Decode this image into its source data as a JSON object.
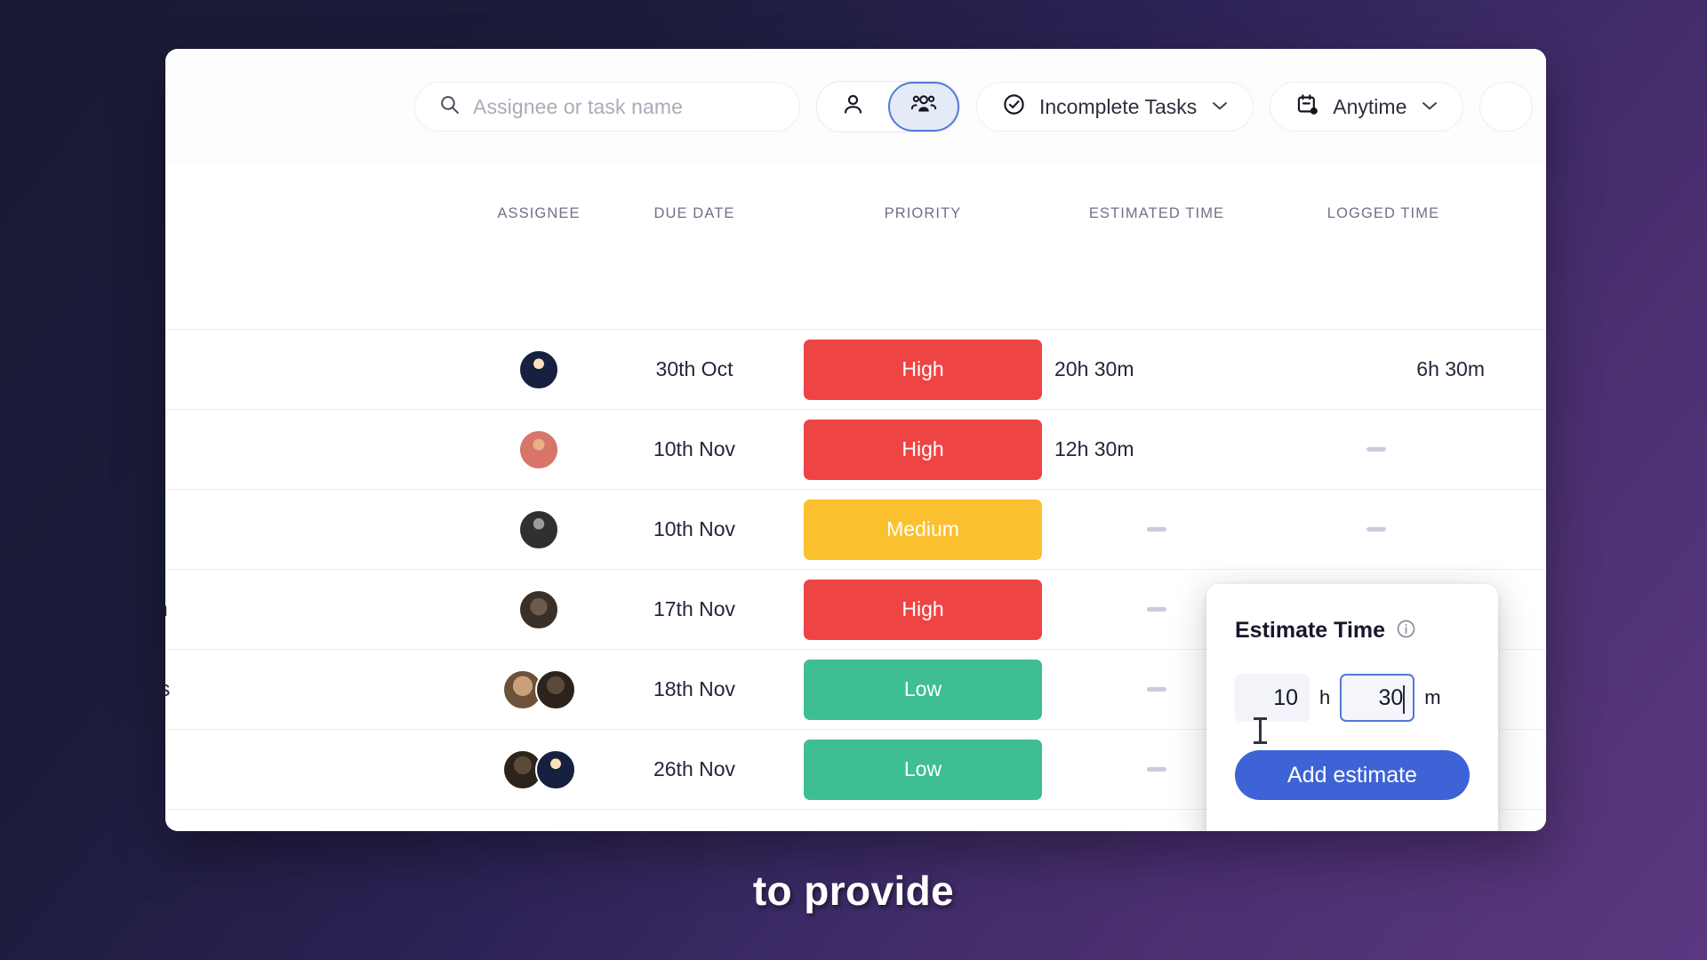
{
  "toolbar": {
    "search": {
      "placeholder": "Assignee or task name",
      "icon": "search-icon"
    },
    "view_toggle": {
      "single_icon": "person-icon",
      "group_icon": "people-group-icon",
      "selected": "group"
    },
    "status_filter": {
      "label": "Incomplete Tasks",
      "icon": "check-circle-icon",
      "chevron": "∨"
    },
    "date_filter": {
      "label": "Anytime",
      "icon": "calendar-icon",
      "chevron": "∨"
    },
    "clipped_filter": {
      "label": ""
    }
  },
  "table": {
    "columns": [
      "ASSIGNEE",
      "DUE DATE",
      "PRIORITY",
      "ESTIMATED TIME",
      "LOGGED TIME"
    ],
    "rows": [
      {
        "task_fragment": "",
        "assignees": 1,
        "due_date": "30th Oct",
        "priority": "High",
        "estimated_time": "20h 30m",
        "logged_time": "6h 30m"
      },
      {
        "task_fragment": "",
        "assignees": 1,
        "due_date": "10th Nov",
        "priority": "High",
        "estimated_time": "12h 30m",
        "logged_time": "—"
      },
      {
        "task_fragment": "",
        "assignees": 1,
        "due_date": "10th Nov",
        "priority": "Medium",
        "estimated_time": "—",
        "logged_time": "—"
      },
      {
        "task_fragment": "on",
        "assignees": 1,
        "due_date": "17th Nov",
        "priority": "High",
        "estimated_time": "—",
        "logged_time": "—"
      },
      {
        "task_fragment": "sis",
        "assignees": 2,
        "due_date": "18th Nov",
        "priority": "Low",
        "estimated_time": "—",
        "logged_time": "—"
      },
      {
        "task_fragment": "",
        "assignees": 2,
        "due_date": "26th Nov",
        "priority": "Low",
        "estimated_time": "—",
        "logged_time": "—"
      }
    ]
  },
  "estimate_popover": {
    "title": "Estimate Time",
    "info_icon": "info-circle-icon",
    "hours_value": "10",
    "hours_unit": "h",
    "minutes_value": "30",
    "minutes_unit": "m",
    "add_button": "Add estimate",
    "focused_field": "minutes"
  },
  "caption": {
    "text": "to provide"
  },
  "colors": {
    "priority_high": "#ee4444",
    "priority_medium": "#fbc02f",
    "priority_low": "#3fbf91",
    "accent_blue": "#3e63d6",
    "focus_blue": "#5179d8",
    "bg_dark": "#191a35",
    "bg_purple": "#5a3780"
  }
}
